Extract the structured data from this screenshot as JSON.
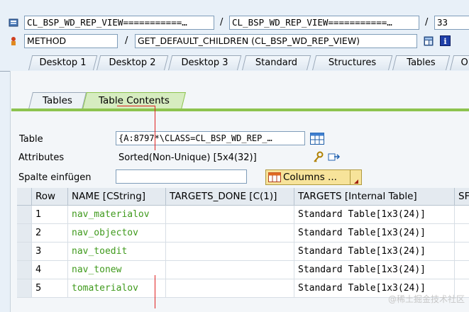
{
  "header": {
    "class1": "CL_BSP_WD_REP_VIEW===========…",
    "class2": "CL_BSP_WD_REP_VIEW===========…",
    "sep": "/",
    "num": "33",
    "kind": "METHOD",
    "method": "GET_DEFAULT_CHILDREN (CL_BSP_WD_REP_VIEW)"
  },
  "tabs": [
    "Desktop 1",
    "Desktop 2",
    "Desktop 3",
    "Standard",
    "Structures",
    "Tables",
    "Ol"
  ],
  "subtabs": [
    "Tables",
    "Table Contents"
  ],
  "form": {
    "table_label": "Table",
    "table_value": "{A:8797*\\CLASS=CL_BSP_WD_REP_…",
    "attr_label": "Attributes",
    "attr_value": "Sorted(Non-Unique) [5x4(32)]",
    "insert_label": "Spalte einfügen",
    "insert_value": "",
    "columns_button": "Columns ..."
  },
  "table": {
    "headers": [
      "Row",
      "NAME [CString]",
      "TARGETS_DONE [C(1)]",
      "TARGETS [Internal Table]",
      "SF"
    ],
    "rows": [
      {
        "row": "1",
        "name": "nav_materialov",
        "done": "",
        "targets": "Standard Table[1x3(24)]"
      },
      {
        "row": "2",
        "name": "nav_objectov",
        "done": "",
        "targets": "Standard Table[1x3(24)]"
      },
      {
        "row": "3",
        "name": "nav_toedit",
        "done": "",
        "targets": "Standard Table[1x3(24)]"
      },
      {
        "row": "4",
        "name": "nav_tonew",
        "done": "",
        "targets": "Standard Table[1x3(24)]"
      },
      {
        "row": "5",
        "name": "tomaterialov",
        "done": "",
        "targets": "Standard Table[1x3(24)]"
      }
    ]
  },
  "watermark": "@稀土掘金技术社区"
}
